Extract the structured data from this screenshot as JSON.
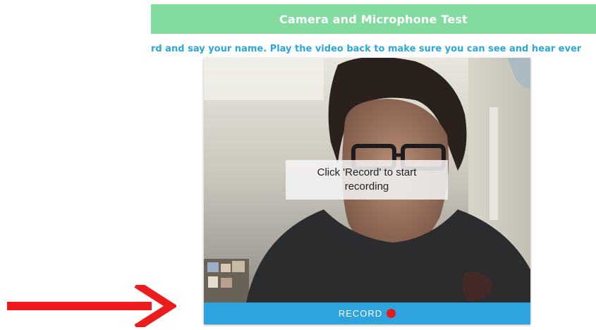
{
  "header": {
    "title": "Camera and Microphone Test"
  },
  "instructions": {
    "text": "rd and say your name. Play the video back to make sure you can see and hear ever"
  },
  "video": {
    "overlay_text": "Click 'Record' to start recording",
    "record_label": "RECORD"
  },
  "colors": {
    "header_bar": "#82dca0",
    "instructions_text": "#2aa7dc",
    "record_bar": "#2ea4df",
    "record_dot": "#e41b1b",
    "annotation_arrow": "#ec1c1c"
  },
  "icons": {
    "record_indicator": "record-dot-icon",
    "annotation": "red-arrow-icon"
  }
}
